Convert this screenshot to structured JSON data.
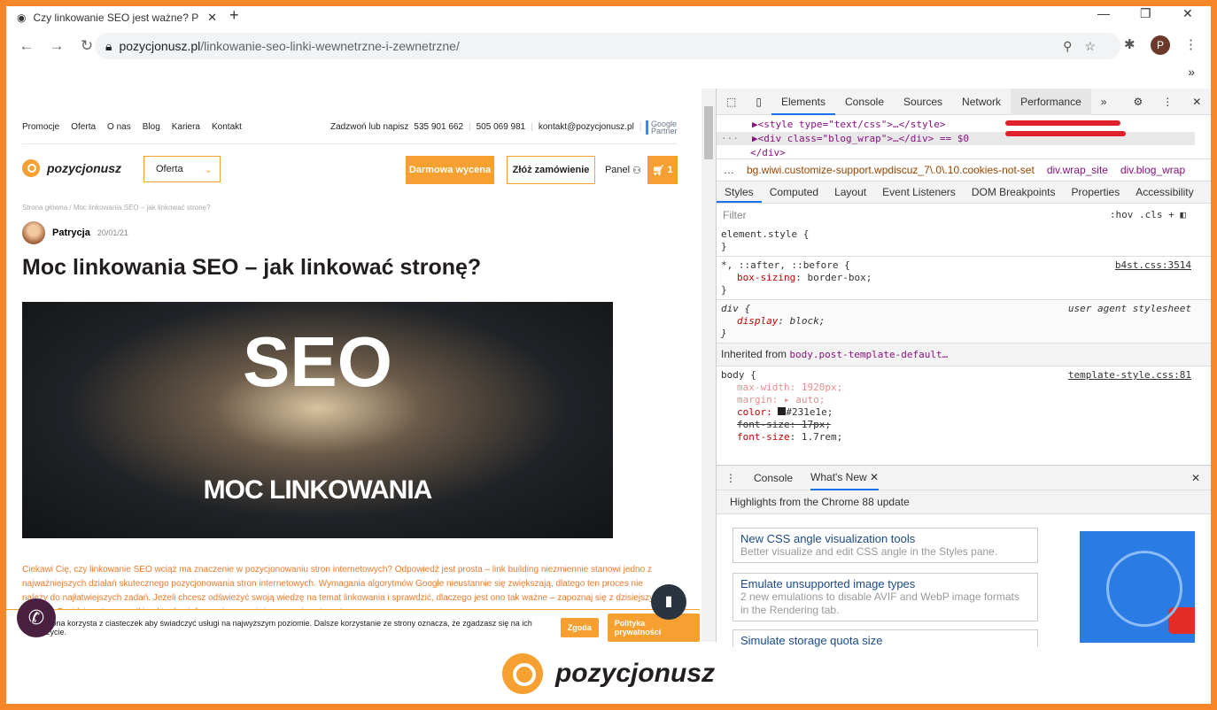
{
  "browser": {
    "tab_title": "Czy linkowanie SEO jest ważne? P",
    "url_host": "pozycjonusz.pl",
    "url_path": "/linkowanie-seo-linki-wewnetrzne-i-zewnetrzne/",
    "profile": "P"
  },
  "site": {
    "nav": [
      "Promocje",
      "Oferta",
      "O nas",
      "Blog",
      "Kariera",
      "Kontakt"
    ],
    "contact": {
      "label": "Zadzwoń lub napisz",
      "phone1": "535 901 662",
      "phone2": "505 069 981",
      "email": "kontakt@pozycjonusz.pl"
    },
    "partner": "Google Partner",
    "logo": "pozycjonusz",
    "oferta_select": "Oferta",
    "free_quote": "Darmowa wycena",
    "order": "Złóż zamówienie",
    "panel": "Panel",
    "cart_count": "1",
    "breadcrumb": "Strona główna / Moc linkowania SEO – jak linkować stronę?",
    "author": "Patrycja",
    "date": "20/01/21",
    "title": "Moc linkowania SEO – jak linkować stronę?",
    "hero_big": "SEO",
    "hero_small": "MOC LINKOWANIA",
    "intro": "Ciekawi Cię, czy linkowanie SEO wciąż ma znaczenie w pozycjonowaniu stron internetowych? Odpowiedź jest prosta – link building niezmiennie stanowi jedno z najważniejszych działań skutecznego pozycjonowania stron internetowych. Wymagania algorytmów Google nieustannie się zwiększają, dlatego ten proces nie należy do najłatwiejszych zadań. Jeżeli chcesz odświeżyć swoją wiedzę na temat linkowania i sprawdzić, dlaczego jest ono tak ważne – zapoznaj się z dzisiejszym wpisem. Znajdziesz tu wszystkie aktualne informacje na wyżej wspomniany temat.",
    "cookie_text": "Strona korzysta z ciasteczek aby świadczyć usługi na najwyższym poziomie. Dalsze korzystanie ze strony oznacza, że zgadzasz się na ich użycie.",
    "cookie_accept": "Zgoda",
    "cookie_policy": "Polityka prywatności"
  },
  "devtools": {
    "tabs": [
      "Elements",
      "Console",
      "Sources",
      "Network",
      "Performance"
    ],
    "dom": {
      "l1": "▶<style type=\"text/css\">…</style>",
      "l2": "▶<div class=\"blog_wrap\">…</div> == $0",
      "l3": "</div>"
    },
    "crumbs": [
      "bg.wiwi.customize-support.wpdiscuz_7\\.0\\.10.cookies-not-set",
      "div.wrap_site",
      "div.blog_wrap"
    ],
    "style_tabs": [
      "Styles",
      "Computed",
      "Layout",
      "Event Listeners",
      "DOM Breakpoints",
      "Properties",
      "Accessibility"
    ],
    "filter_placeholder": "Filter",
    "hov": ":hov",
    "cls": ".cls",
    "rules": {
      "r1": "element.style {",
      "r2sel": "*, ::after, ::before {",
      "r2src": "b4st.css:3514",
      "r2p": "box-sizing",
      "r2v": "border-box;",
      "r3sel": "div {",
      "r3src": "user agent stylesheet",
      "r3p": "display",
      "r3v": "block;",
      "inh_label": "Inherited from",
      "inh_sel": "body.post-template-default…",
      "r4sel": "body {",
      "r4src": "template-style.css:81",
      "p1": "max-width: 1920px;",
      "p2": "margin: ▸ auto;",
      "p3": "color:",
      "p3v": "#231e1e;",
      "p4": "font-size: 17px;",
      "p5": "font-size: 1.7rem;"
    },
    "drawer": {
      "tabs": [
        "Console",
        "What's New"
      ],
      "highlight": "Highlights from the Chrome 88 update",
      "cards": [
        {
          "title": "New CSS angle visualization tools",
          "desc": "Better visualize and edit CSS angle in the Styles pane."
        },
        {
          "title": "Emulate unsupported image types",
          "desc": "2 new emulations to disable AVIF and WebP image formats in the Rendering tab."
        },
        {
          "title": "Simulate storage quota size",
          "desc": ""
        }
      ]
    }
  },
  "footer_logo": "pozycjonusz",
  "colors": {
    "frame": "#f5862a",
    "brand": "#f5a030",
    "devtools_accent": "#1a73e8"
  }
}
